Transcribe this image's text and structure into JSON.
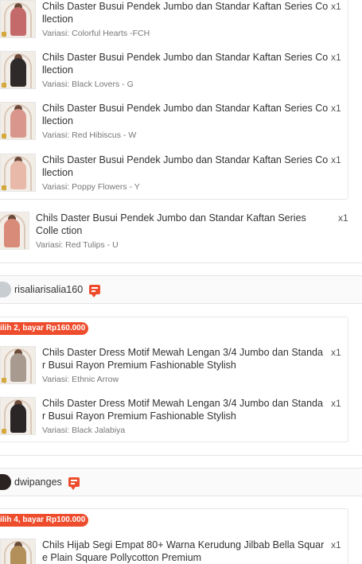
{
  "group1": {
    "items": [
      {
        "name": "Chils Daster Busui Pendek Jumbo dan Standar Kaftan Series Co llection",
        "variant": "Variasi: Colorful Hearts -FCH",
        "qty": "x1",
        "color": "#c46a6a"
      },
      {
        "name": "Chils Daster Busui Pendek Jumbo dan Standar Kaftan Series Co llection",
        "variant": "Variasi: Black Lovers - G",
        "qty": "x1",
        "color": "#2e2a2a"
      },
      {
        "name": "Chils Daster Busui Pendek Jumbo dan Standar Kaftan Series Co llection",
        "variant": "Variasi: Red Hibiscus - W",
        "qty": "x1",
        "color": "#d9968c"
      },
      {
        "name": "Chils Daster Busui Pendek Jumbo dan Standar Kaftan Series Co llection",
        "variant": "Variasi: Poppy Flowers - Y",
        "qty": "x1",
        "color": "#e8b9a8"
      }
    ],
    "single": {
      "name": "Chils Daster Busui Pendek Jumbo dan Standar Kaftan Series Colle ction",
      "variant": "Variasi: Red Tulips - U",
      "qty": "x1",
      "color": "#d98b7a"
    }
  },
  "seller2": {
    "name": "risaliarisalia160",
    "promo": "ilih 2, bayar Rp160.000",
    "items": [
      {
        "name": "Chils Daster Dress Motif Mewah Lengan 3/4 Jumbo dan Standa r Busui Rayon Premium Fashionable Stylish",
        "variant": "Variasi: Ethnic Arrow",
        "qty": "x1",
        "color": "#a89a8f"
      },
      {
        "name": "Chils Daster Dress Motif Mewah Lengan 3/4 Jumbo dan Standa r Busui Rayon Premium Fashionable Stylish",
        "variant": "Variasi: Black Jalabiya",
        "qty": "x1",
        "color": "#2b2626"
      }
    ]
  },
  "seller3": {
    "name": "dwipanges",
    "promo": "ilih 4, bayar Rp100.000",
    "items": [
      {
        "name": "Chils Hijab Segi Empat 80+ Warna Kerudung Jilbab Bella Squar e Plain Square Pollycotton Premium",
        "variant": "",
        "qty": "x1",
        "color": "#b38f5a"
      }
    ]
  },
  "icons": {
    "chat": "chat-icon",
    "avatar": "avatar"
  }
}
